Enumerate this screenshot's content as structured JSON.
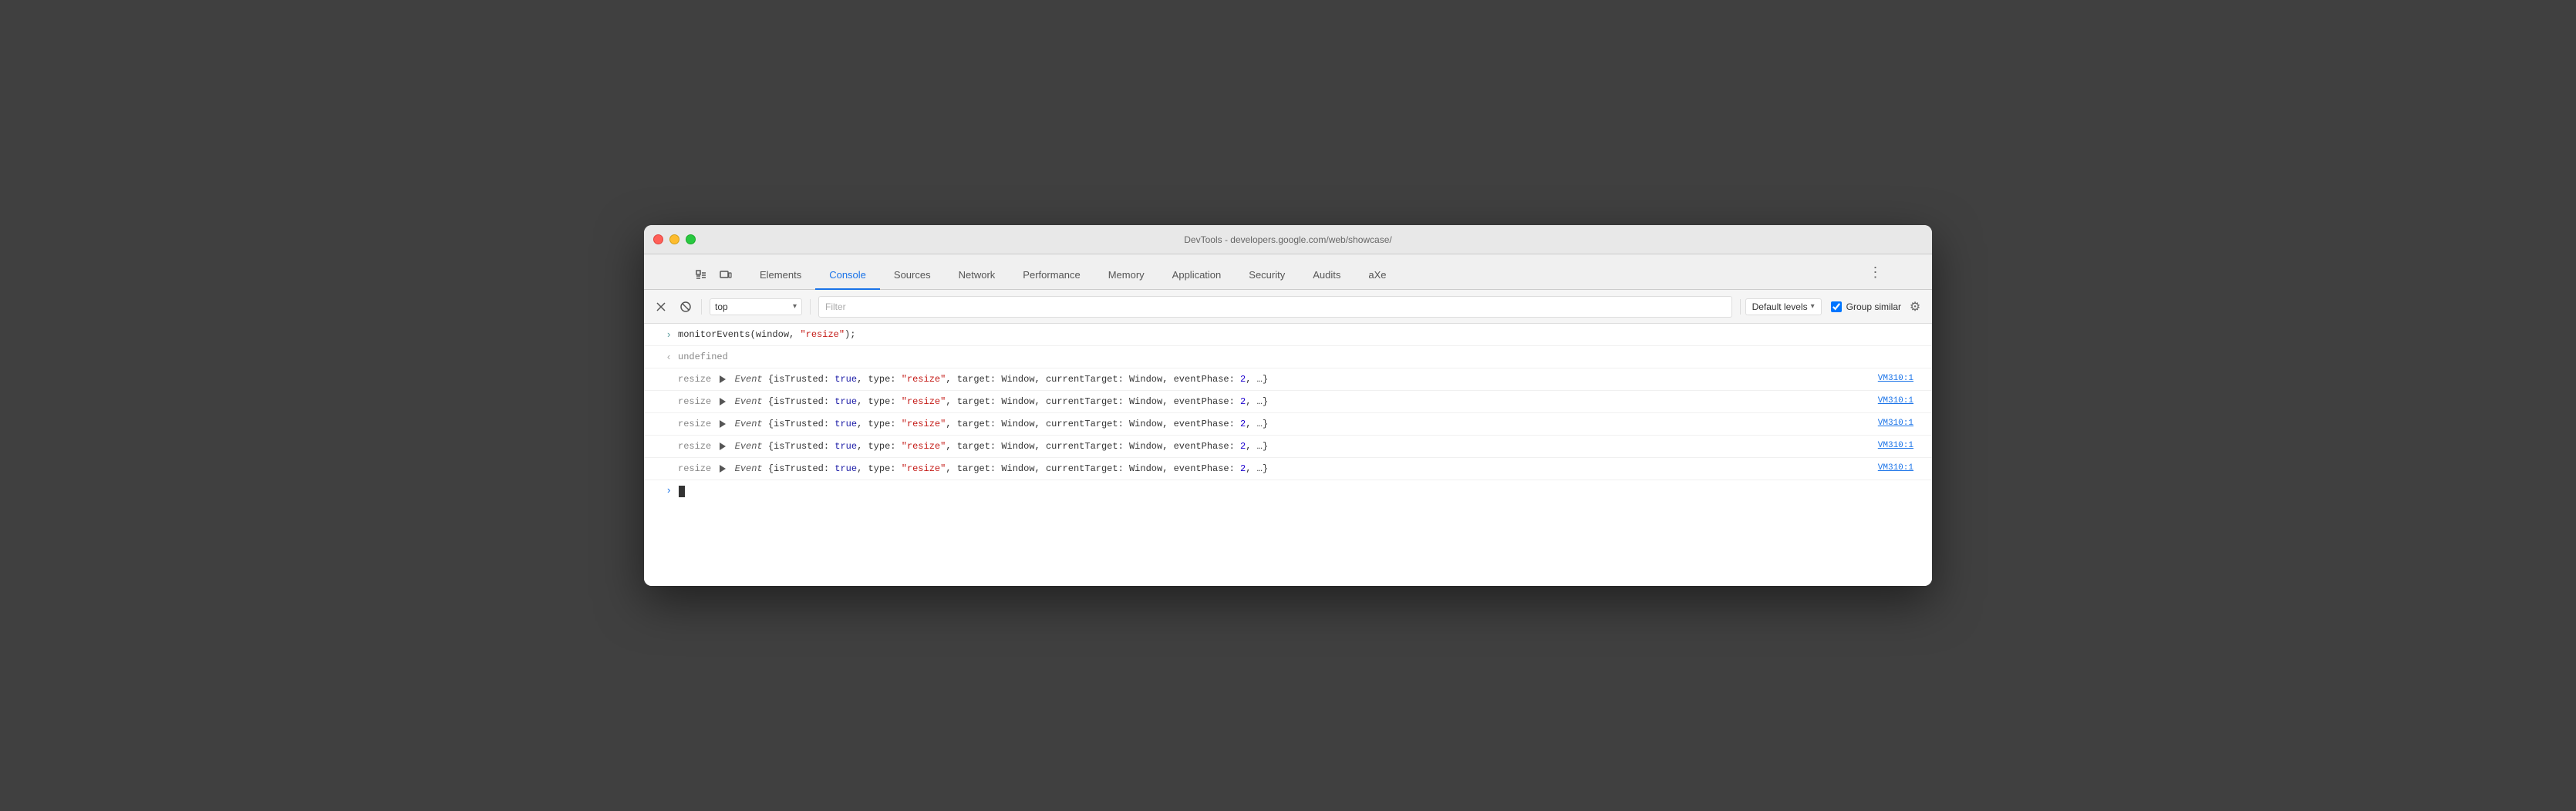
{
  "window": {
    "title": "DevTools - developers.google.com/web/showcase/"
  },
  "tabs": {
    "items": [
      {
        "label": "Elements",
        "active": false
      },
      {
        "label": "Console",
        "active": true
      },
      {
        "label": "Sources",
        "active": false
      },
      {
        "label": "Network",
        "active": false
      },
      {
        "label": "Performance",
        "active": false
      },
      {
        "label": "Memory",
        "active": false
      },
      {
        "label": "Application",
        "active": false
      },
      {
        "label": "Security",
        "active": false
      },
      {
        "label": "Audits",
        "active": false
      },
      {
        "label": "aXe",
        "active": false
      }
    ]
  },
  "toolbar": {
    "context_value": "top",
    "filter_placeholder": "Filter",
    "levels_label": "Default levels",
    "group_similar_label": "Group similar",
    "group_similar_checked": true
  },
  "console": {
    "command_line": "monitorEvents(window, \"resize\");",
    "undefined_response": "undefined",
    "resize_rows": [
      {
        "label": "resize",
        "content_plain": "Event {isTrusted: true, type: \"resize\", target: Window, currentTarget: Window, eventPhase: 2, …}",
        "source": "VM310:1"
      },
      {
        "label": "resize",
        "content_plain": "Event {isTrusted: true, type: \"resize\", target: Window, currentTarget: Window, eventPhase: 2, …}",
        "source": "VM310:1"
      },
      {
        "label": "resize",
        "content_plain": "Event {isTrusted: true, type: \"resize\", target: Window, currentTarget: Window, eventPhase: 2, …}",
        "source": "VM310:1"
      },
      {
        "label": "resize",
        "content_plain": "Event {isTrusted: true, type: \"resize\", target: Window, currentTarget: Window, eventPhase: 2, …}",
        "source": "VM310:1"
      },
      {
        "label": "resize",
        "content_plain": "Event {isTrusted: true, type: \"resize\", target: Window, currentTarget: Window, eventPhase: 2, …}",
        "source": "VM310:1"
      }
    ],
    "string_resize": "\"resize\"",
    "keyword_true": "true",
    "keyword_isTrusted": "isTrusted:",
    "keyword_type": "type:",
    "keyword_target": "target:",
    "keyword_currentTarget": "currentTarget:",
    "keyword_eventPhase": "eventPhase:",
    "value_Window": "Window",
    "value_2": "2"
  },
  "icons": {
    "play_icon": "▶",
    "block_icon": "⊘",
    "arrow_down": "▾",
    "settings_icon": "⚙",
    "more_dots": "⋮"
  }
}
